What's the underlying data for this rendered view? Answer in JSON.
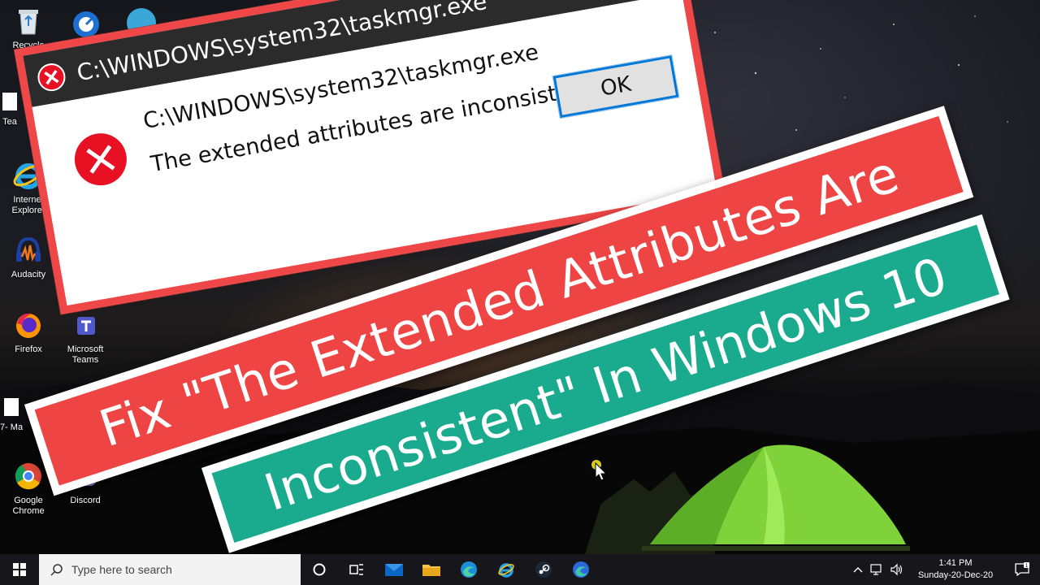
{
  "desktop_icons": [
    {
      "label": "Recycle",
      "icon": "recycle-bin-icon"
    },
    {
      "label": "Tea",
      "icon": "teams-icon"
    },
    {
      "label": "Internet Explorer",
      "icon": "internet-explorer-icon"
    },
    {
      "label": "Audacity",
      "icon": "audacity-icon"
    },
    {
      "label": "Firefox",
      "icon": "firefox-icon"
    },
    {
      "label": "Microsoft Teams",
      "icon": "microsoft-teams-icon"
    },
    {
      "label": "7- Ma",
      "icon": "seven-zip-icon"
    },
    {
      "label": "Google Chrome",
      "icon": "google-chrome-icon"
    },
    {
      "label": "Discord",
      "icon": "discord-icon"
    }
  ],
  "dialog": {
    "title": "C:\\WINDOWS\\system32\\taskmgr.exe",
    "message_path": "C:\\WINDOWS\\system32\\taskmgr.exe",
    "message": "The extended attributes are inconsistent.",
    "ok_label": "OK",
    "title_ghost": "C:\\WINDOWS\\system32\\taskmgr"
  },
  "banners": {
    "line1": "Fix \"The Extended Attributes Are",
    "line2": "Inconsistent\" In Windows 10"
  },
  "taskbar": {
    "search_placeholder": "Type here to search",
    "pinned": [
      "cortana-icon",
      "task-view-icon",
      "mail-icon",
      "file-explorer-icon",
      "edge-icon",
      "internet-explorer-icon",
      "steam-icon",
      "edge-dev-icon"
    ],
    "time": "1:41 PM",
    "date": "Sunday-20-Dec-20"
  },
  "colors": {
    "dialog_border": "#ef4747",
    "banner_red": "#ee4444",
    "banner_green": "#1aab8f",
    "ok_focus": "#0078d7",
    "taskbar_bg": "#17171b"
  }
}
